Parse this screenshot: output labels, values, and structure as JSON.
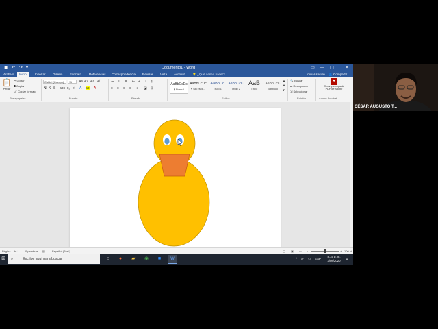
{
  "window": {
    "title": "Documento1 - Word",
    "controls": [
      "▭",
      "—",
      "▢",
      "✕"
    ]
  },
  "tabs": {
    "items": [
      "Archivo",
      "Inicio",
      "Insertar",
      "Diseño",
      "Formato",
      "Referencias",
      "Correspondencia",
      "Revisar",
      "Vista",
      "Acrobat"
    ],
    "tell_me": "¿Qué desea hacer?",
    "sign_in": "Iniciar sesión",
    "share": "Compartir"
  },
  "ribbon": {
    "clipboard": {
      "paste": "Pegar",
      "cut": "Cortar",
      "copy": "Copiar",
      "format_painter": "Copiar formato",
      "group": "Portapapeles"
    },
    "font": {
      "name": "Calibri (Cuerpo)",
      "size": "11",
      "group": "Fuente"
    },
    "paragraph": {
      "group": "Párrafo"
    },
    "styles": {
      "items": [
        {
          "preview": "AaBbCcDc",
          "label": "¶ Normal"
        },
        {
          "preview": "AaBbCcDc",
          "label": "¶ Sin espa..."
        },
        {
          "preview": "AaBbCc",
          "label": "Título 1"
        },
        {
          "preview": "AaBbCcC",
          "label": "Título 2"
        },
        {
          "preview": "AaB",
          "label": "Título"
        },
        {
          "preview": "AaBbCcC",
          "label": "Subtítulo"
        }
      ],
      "group": "Estilos"
    },
    "editing": {
      "find": "Buscar",
      "replace": "Reemplazar",
      "select": "Seleccionar",
      "group": "Edición"
    },
    "acrobat": {
      "create_line1": "Crear y compartir",
      "create_line2": "PDF de Adobe",
      "group": "Adobe Acrobat"
    }
  },
  "status": {
    "page": "Página 1 de 1",
    "words": "0 palabras",
    "language": "Español (Perú)",
    "zoom": "100 %"
  },
  "taskbar": {
    "search_placeholder": "Escribe aquí para buscar",
    "lang": "ESP",
    "time": "8:15 p. m.",
    "date": "3/08/2020"
  },
  "webcam": {
    "name": "CÉSAR AUGUSTO T..."
  },
  "colors": {
    "word_blue": "#2b579a",
    "duck_yellow": "#ffc000",
    "beak_orange": "#ed7d31",
    "eye_blue": "#5b9bd5"
  }
}
